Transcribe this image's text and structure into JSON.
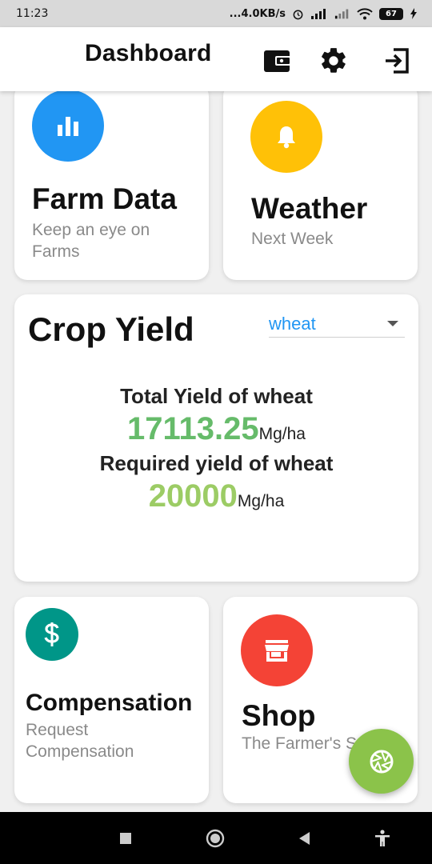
{
  "status_bar": {
    "time": "11:23",
    "network_speed": "...4.0KB/s",
    "battery": "67"
  },
  "app_bar": {
    "title": "Dashboard",
    "icons": [
      "wallet-icon",
      "gear-icon",
      "logout-icon"
    ]
  },
  "cards": {
    "farm_data": {
      "title": "Farm Data",
      "subtitle": "Keep an eye on Farms",
      "icon": "bar-chart-icon",
      "color": "#2196f3"
    },
    "weather": {
      "title": "Weather",
      "subtitle": "Next Week",
      "icon": "bell-icon",
      "color": "#ffc107"
    },
    "compensation": {
      "title": "Compensation",
      "subtitle": "Request Compensation",
      "icon": "dollar-icon",
      "color": "#009688"
    },
    "shop": {
      "title": "Shop",
      "subtitle": "The Farmer's S",
      "icon": "store-icon",
      "color": "#f44336"
    }
  },
  "crop_yield": {
    "title": "Crop Yield",
    "selected_crop": "wheat",
    "total_label": "Total Yield of wheat",
    "total_value": "17113.25",
    "total_unit": "Mg/ha",
    "required_label": "Required yield of wheat",
    "required_value": "20000",
    "required_unit": "Mg/ha",
    "total_color": "#66bb6a",
    "required_color": "#9ccc65"
  },
  "fab": {
    "icon": "camera-aperture-icon",
    "color": "#8bc34a"
  },
  "nav_bar": {
    "icons": [
      "recents-icon",
      "home-icon",
      "back-icon",
      "accessibility-icon"
    ]
  }
}
